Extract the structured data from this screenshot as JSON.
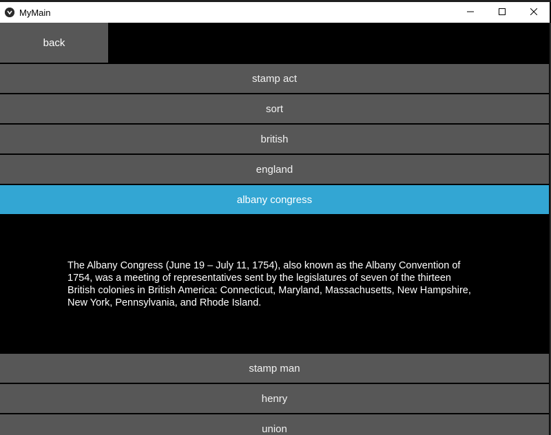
{
  "window": {
    "title": "MyMain",
    "controls": {
      "minimize_icon": "minimize-icon",
      "maximize_icon": "maximize-icon",
      "close_icon": "close-icon"
    }
  },
  "toolbar": {
    "back_label": "back"
  },
  "items": [
    {
      "label": "stamp act"
    },
    {
      "label": "sort"
    },
    {
      "label": "british"
    },
    {
      "label": "england"
    },
    {
      "label": "albany congress",
      "selected": true
    },
    {
      "label": "stamp man"
    },
    {
      "label": "henry"
    },
    {
      "label": "union"
    }
  ],
  "detail": {
    "text": "The Albany Congress (June 19 – July 11, 1754), also known as the Albany Convention of 1754, was a meeting of representatives sent by the legislatures of seven of the thirteen British colonies in British America: Connecticut, Maryland, Massachusetts, New Hampshire, New York, Pennsylvania, and Rhode Island."
  },
  "colors": {
    "item_bg": "#575757",
    "selected_bg": "#33a6d3",
    "text": "#ffffff",
    "background": "#000000"
  }
}
